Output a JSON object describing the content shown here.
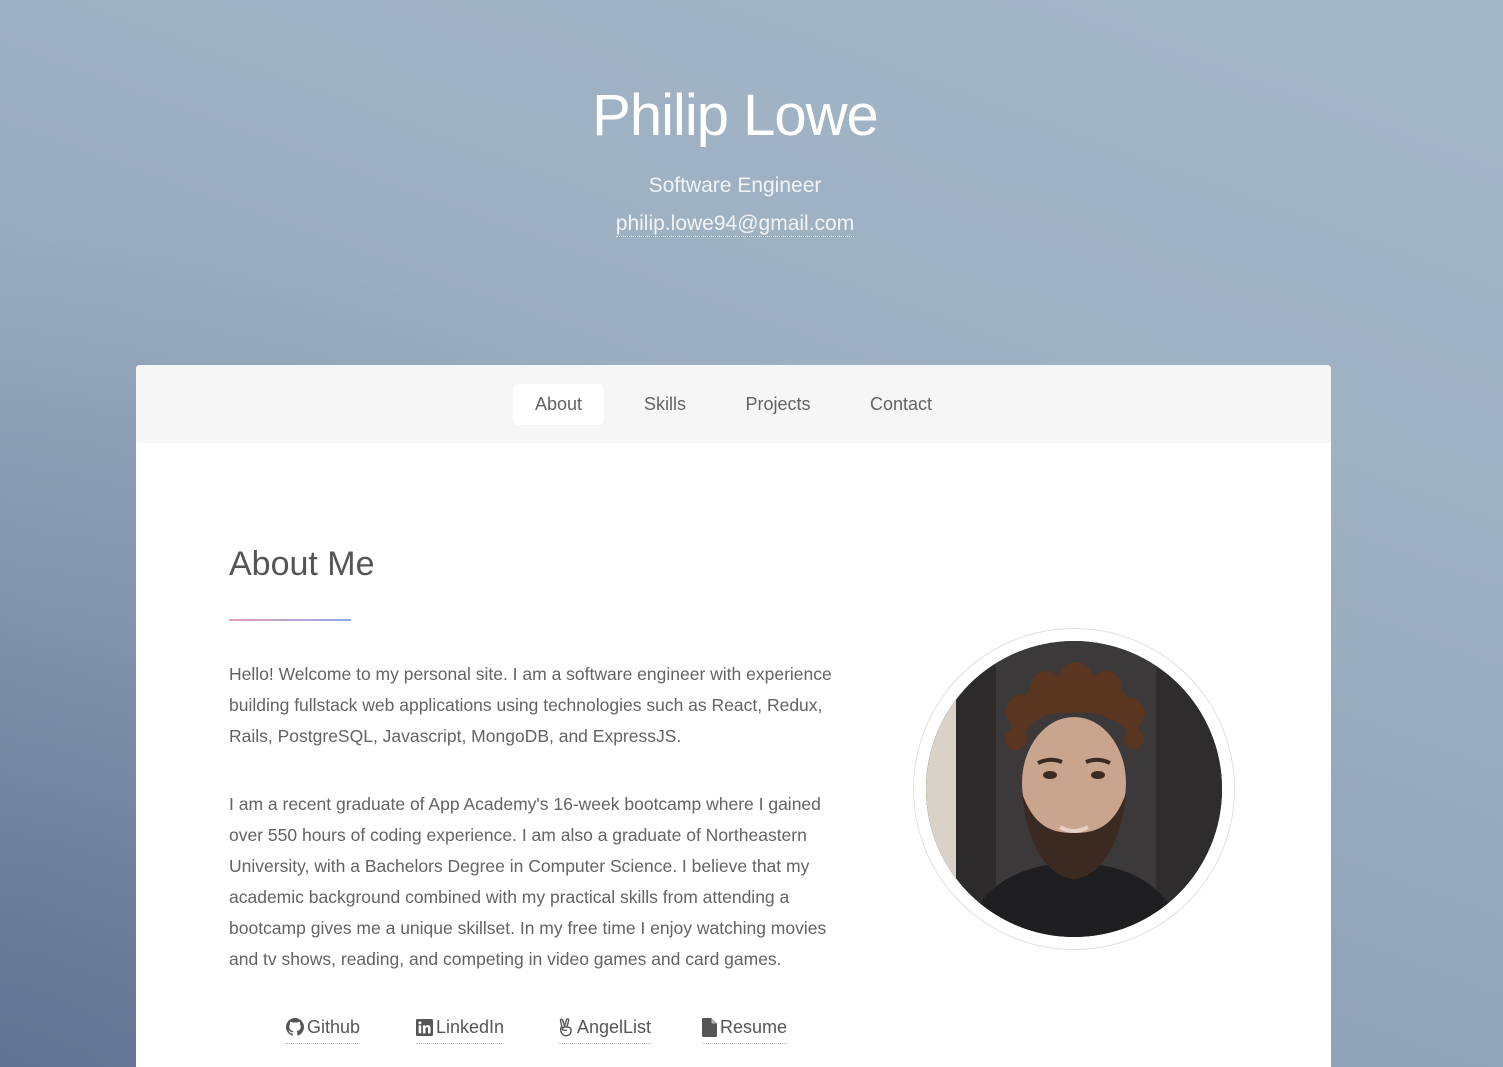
{
  "header": {
    "name": "Philip Lowe",
    "role": "Software Engineer",
    "email": "philip.lowe94@gmail.com"
  },
  "nav": {
    "items": [
      {
        "label": "About",
        "active": true
      },
      {
        "label": "Skills",
        "active": false
      },
      {
        "label": "Projects",
        "active": false
      },
      {
        "label": "Contact",
        "active": false
      }
    ]
  },
  "about": {
    "title": "About Me",
    "paragraphs": [
      "Hello! Welcome to my personal site. I am a software engineer with experience building fullstack web applications using technologies such as React, Redux, Rails, PostgreSQL, Javascript, MongoDB, and ExpressJS.",
      "I am a recent graduate of App Academy's 16-week bootcamp where I gained over 550 hours of coding experience. I am also a graduate of Northeastern University, with a Bachelors Degree in Computer Science. I believe that my academic background combined with my practical skills from attending a bootcamp gives me a unique skillset. In my free time I enjoy watching movies and tv shows, reading, and competing in video games and card games."
    ],
    "links": [
      {
        "label": "Github",
        "icon": "github-icon"
      },
      {
        "label": "LinkedIn",
        "icon": "linkedin-icon"
      },
      {
        "label": "AngelList",
        "icon": "angellist-icon"
      },
      {
        "label": "Resume",
        "icon": "file-icon"
      }
    ]
  },
  "colors": {
    "accent_rule_start": "#e99fb4",
    "accent_rule_end": "#8aa9e8"
  }
}
